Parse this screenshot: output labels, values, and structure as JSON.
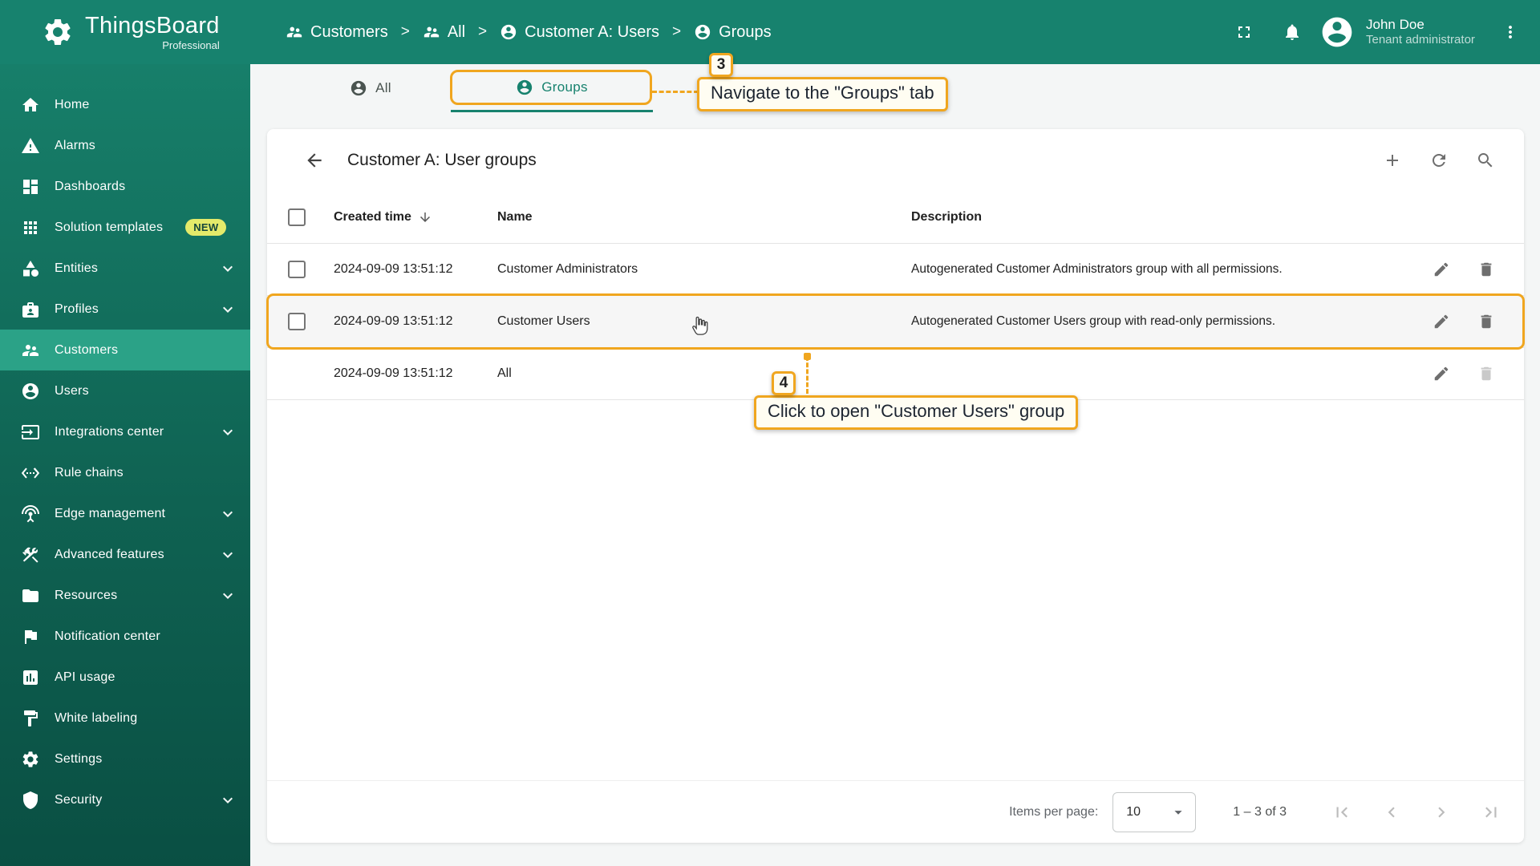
{
  "app": {
    "name": "ThingsBoard",
    "edition": "Professional"
  },
  "header": {
    "breadcrumb": [
      {
        "label": "Customers"
      },
      {
        "label": "All"
      },
      {
        "label": "Customer A: Users"
      },
      {
        "label": "Groups"
      }
    ],
    "separator": ">",
    "user": {
      "name": "John Doe",
      "role": "Tenant administrator"
    }
  },
  "sidebar": {
    "items": [
      {
        "label": "Home"
      },
      {
        "label": "Alarms"
      },
      {
        "label": "Dashboards"
      },
      {
        "label": "Solution templates",
        "badge": "NEW"
      },
      {
        "label": "Entities"
      },
      {
        "label": "Profiles"
      },
      {
        "label": "Customers"
      },
      {
        "label": "Users"
      },
      {
        "label": "Integrations center"
      },
      {
        "label": "Rule chains"
      },
      {
        "label": "Edge management"
      },
      {
        "label": "Advanced features"
      },
      {
        "label": "Resources"
      },
      {
        "label": "Notification center"
      },
      {
        "label": "API usage"
      },
      {
        "label": "White labeling"
      },
      {
        "label": "Settings"
      },
      {
        "label": "Security"
      }
    ]
  },
  "tabs": [
    {
      "label": "All"
    },
    {
      "label": "Groups"
    }
  ],
  "page": {
    "title": "Customer A: User groups"
  },
  "table": {
    "columns": {
      "created": "Created time",
      "name": "Name",
      "description": "Description"
    },
    "rows": [
      {
        "created": "2024-09-09 13:51:12",
        "name": "Customer Administrators",
        "description": "Autogenerated Customer Administrators group with all permissions."
      },
      {
        "created": "2024-09-09 13:51:12",
        "name": "Customer Users",
        "description": "Autogenerated Customer Users group with read-only permissions."
      },
      {
        "created": "2024-09-09 13:51:12",
        "name": "All",
        "description": ""
      }
    ]
  },
  "pagination": {
    "label": "Items per page:",
    "per_page": "10",
    "range": "1 – 3 of 3"
  },
  "callouts": {
    "step3": {
      "number": "3",
      "text": "Navigate to the \"Groups\" tab"
    },
    "step4": {
      "number": "4",
      "text": "Click to open \"Customer Users\" group"
    }
  },
  "colors": {
    "primary": "#17826e",
    "accent": "#f0a61f"
  }
}
